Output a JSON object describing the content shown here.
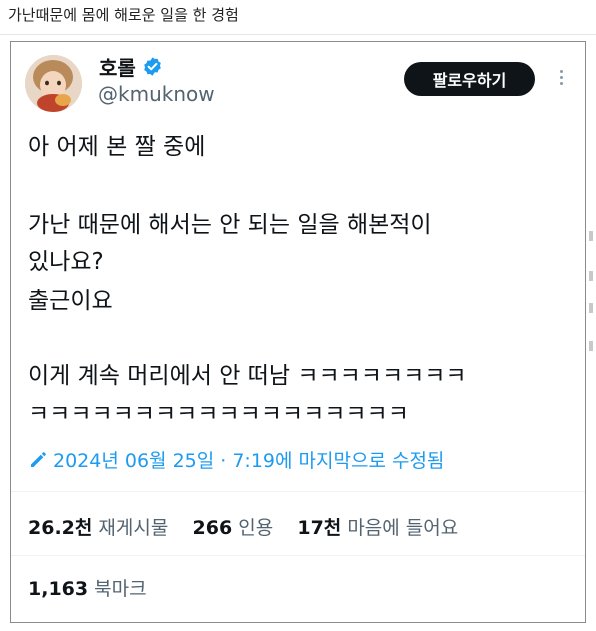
{
  "page": {
    "title": "가난때문에 몸에 해로운 일을 한 경험"
  },
  "tweet": {
    "author_name": "호롤",
    "handle": "@kmuknow",
    "follow_label": "팔로우하기",
    "lines": [
      "아 어제 본 짤 중에",
      "가난 때문에 해서는 안 되는 일을 해본적이",
      "있나요?",
      "출근이요",
      "이게 계속 머리에서 안 떠남 ㅋㅋㅋㅋㅋㅋㅋㅋ",
      "ㅋㅋㅋㅋㅋㅋㅋㅋㅋㅋㅋㅋㅋㅋㅋㅋㅋㅋ"
    ],
    "edited_text": "2024년 06월 25일 · 7:19에 마지막으로 수정됨",
    "stats": {
      "retweets_count": "26.2천",
      "retweets_label": "재게시물",
      "quotes_count": "266",
      "quotes_label": "인용",
      "likes_count": "17천",
      "likes_label": "마음에 들어요"
    },
    "bookmarks_count": "1,163",
    "bookmarks_label": "북마크"
  },
  "colors": {
    "accent": "#1d9bf0",
    "text": "#0f1419",
    "muted": "#536471",
    "button": "#0f1419"
  },
  "icons": [
    "verified-badge-icon",
    "more-options-icon",
    "edit-pencil-icon"
  ]
}
